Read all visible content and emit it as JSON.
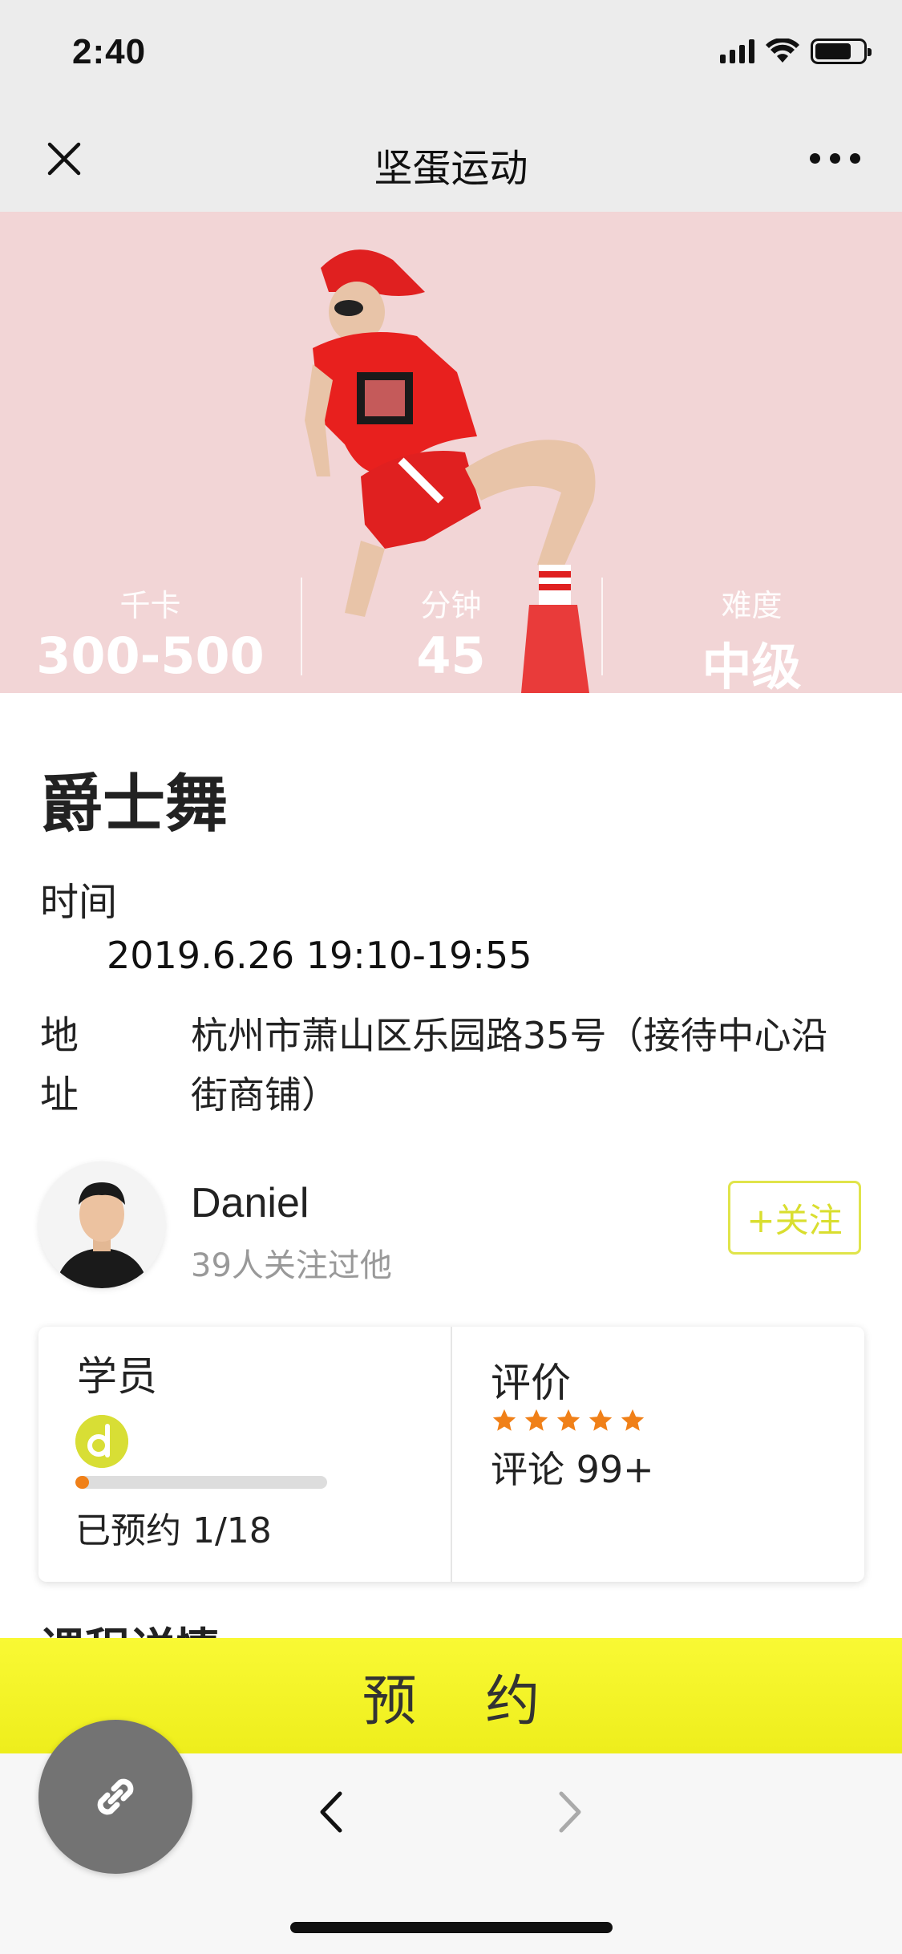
{
  "status_bar": {
    "time": "2:40"
  },
  "nav": {
    "title": "坚蛋运动",
    "close_icon": "close-icon",
    "more_icon": "more-icon"
  },
  "hero": {
    "stats": [
      {
        "label": "千卡",
        "value": "300-500"
      },
      {
        "label": "分钟",
        "value": "45"
      },
      {
        "label": "难度",
        "value": "中级"
      }
    ]
  },
  "course": {
    "title": "爵士舞",
    "time_label": "时间",
    "time_value": "2019.6.26 19:10-19:55",
    "address_label": "地址",
    "address_value": "杭州市萧山区乐园路35号（接待中心沿街商铺）"
  },
  "coach": {
    "name": "Daniel",
    "followers": "39人关注过他",
    "follow_label": "+关注"
  },
  "card": {
    "students_title": "学员",
    "booked_text": "已预约 1/18",
    "booked_progress": 0.0556,
    "reviews_title": "评价",
    "rating": 5,
    "reviews_text": "评论 99+"
  },
  "section_peek": "课程详情",
  "book_button": "预 约",
  "colors": {
    "accent_yellow": "#f2f226",
    "follow_yellow": "#d9de2f",
    "star_orange": "#f08018",
    "hero_bg": "#f2d5d6"
  }
}
